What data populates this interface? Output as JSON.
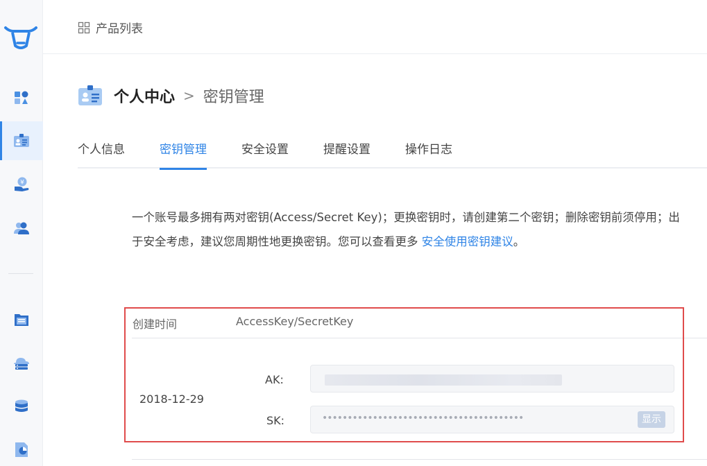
{
  "sidebar": {
    "items": [
      {
        "icon": "shapes-icon"
      },
      {
        "icon": "id-card-icon",
        "active": true
      },
      {
        "icon": "hand-yuan-icon"
      },
      {
        "icon": "users-icon"
      },
      {
        "icon": "document-icon"
      },
      {
        "icon": "cloud-server-icon"
      },
      {
        "icon": "database-icon"
      },
      {
        "icon": "report-chart-icon"
      }
    ]
  },
  "topbar": {
    "product_list_label": "产品列表"
  },
  "header": {
    "title": "个人中心",
    "separator": ">",
    "subtitle": "密钥管理"
  },
  "tabs": [
    {
      "label": "个人信息"
    },
    {
      "label": "密钥管理",
      "active": true
    },
    {
      "label": "安全设置"
    },
    {
      "label": "提醒设置"
    },
    {
      "label": "操作日志"
    }
  ],
  "description": {
    "text": "一个账号最多拥有两对密钥(Access/Secret Key)；更换密钥时，请创建第二个密钥；删除密钥前须停用；出于安全考虑，建议您周期性地更换密钥。您可以查看更多 ",
    "link": "安全使用密钥建议",
    "suffix": "。"
  },
  "key_table": {
    "columns": [
      "创建时间",
      "AccessKey/SecretKey"
    ],
    "rows": [
      {
        "created": "2018-12-29",
        "ak_label": "AK:",
        "sk_label": "SK:",
        "sk_masked": "••••••••••••••••••••••••••••••••••••••••",
        "show_label": "显示"
      }
    ]
  },
  "colors": {
    "accent": "#2f84e6",
    "highlight": "#e04b4b"
  }
}
